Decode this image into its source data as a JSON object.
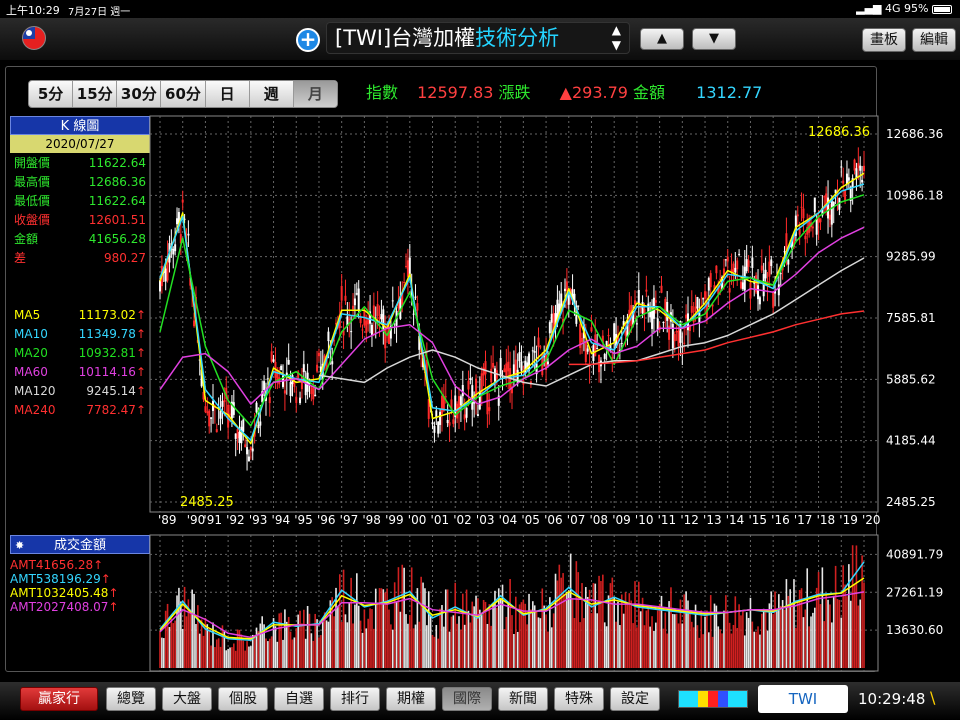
{
  "status": {
    "time": "上午10:29",
    "date": "7月27日 週一",
    "signal": "4G",
    "battery": "95%"
  },
  "header": {
    "title_prefix": "[TWI]",
    "title_main": "台灣加權",
    "title_accent": "技術分析",
    "btn_board": "畫板",
    "btn_edit": "編輯"
  },
  "periods": [
    "5分",
    "15分",
    "30分",
    "60分",
    "日",
    "週",
    "月"
  ],
  "active_period": "月",
  "quote": {
    "index_label": "指數",
    "index_value": "12597.83",
    "change_label": "漲跌",
    "change_value": "▲293.79",
    "amount_label": "金額",
    "amount_value": "1312.77"
  },
  "kline": {
    "header": "K 線圖",
    "date": "2020/07/27",
    "fields": [
      {
        "label": "開盤價",
        "value": "11622.64",
        "color": "#2ee82e"
      },
      {
        "label": "最高價",
        "value": "12686.36",
        "color": "#2ee82e"
      },
      {
        "label": "最低價",
        "value": "11622.64",
        "color": "#2ee82e"
      },
      {
        "label": "收盤價",
        "value": "12601.51",
        "color": "#ff3030"
      },
      {
        "label": "金額",
        "value": "41656.28",
        "color": "#2ee82e"
      },
      {
        "label": "差",
        "value": "980.27",
        "color": "#ff3030"
      }
    ],
    "ma": [
      {
        "label": "MA5",
        "value": "11173.02",
        "arrow": "↑",
        "color": "#ffff00"
      },
      {
        "label": "MA10",
        "value": "11349.78",
        "arrow": "↑",
        "color": "#34d6ff"
      },
      {
        "label": "MA20",
        "value": "10932.81",
        "arrow": "↑",
        "color": "#22e022"
      },
      {
        "label": "MA60",
        "value": "10114.16",
        "arrow": "↑",
        "color": "#e040e0"
      },
      {
        "label": "MA120",
        "value": "9245.14",
        "arrow": "↑",
        "color": "#d8d8d8"
      },
      {
        "label": "MA240",
        "value": "7782.47",
        "arrow": "↑",
        "color": "#ff3030"
      }
    ]
  },
  "volume": {
    "header": "成交金額",
    "fields": [
      {
        "label": "AMT",
        "value": "41656.28",
        "arrow": "↑",
        "color": "#ff3030"
      },
      {
        "label": "AMT5",
        "value": "38196.29",
        "arrow": "↑",
        "color": "#34d6ff"
      },
      {
        "label": "AMT10",
        "value": "32405.48",
        "arrow": "↑",
        "color": "#ffff00"
      },
      {
        "label": "AMT20",
        "value": "27408.07",
        "arrow": "↑",
        "color": "#e040e0"
      }
    ]
  },
  "nav": [
    "總覽",
    "大盤",
    "個股",
    "自選",
    "排行",
    "期權",
    "國際",
    "新聞",
    "特殊",
    "設定"
  ],
  "nav_active": "國際",
  "brand": "贏家行",
  "bottom": {
    "symbol": "TWI",
    "clock": "10:29:48"
  },
  "chart_data": [
    {
      "type": "line",
      "title": "K 線圖",
      "x": [
        "'89",
        "'90",
        "'91",
        "'92",
        "'93",
        "'94",
        "'95",
        "'96",
        "'97",
        "'98",
        "'99",
        "'00",
        "'01",
        "'02",
        "'03",
        "'04",
        "'05",
        "'06",
        "'07",
        "'08",
        "'09",
        "'10",
        "'11",
        "'12",
        "'13",
        "'14",
        "'15",
        "'16",
        "'17",
        "'18",
        "'19",
        "'20"
      ],
      "y_ticks": [
        "12686.36",
        "10986.18",
        "9285.99",
        "7585.81",
        "5885.62",
        "4185.44",
        "2485.25"
      ],
      "ylim": [
        2485.25,
        12686.36
      ],
      "annotations": {
        "max": "12686.36",
        "min": "2485.25"
      },
      "series": [
        {
          "name": "MA5",
          "values": [
            8600,
            10500,
            5300,
            4900,
            4100,
            6200,
            5800,
            5900,
            7800,
            7800,
            7300,
            8800,
            4800,
            5000,
            5500,
            5900,
            6100,
            6700,
            8400,
            6600,
            6900,
            8000,
            7800,
            7300,
            8000,
            8900,
            8600,
            8500,
            10100,
            10500,
            11200,
            11600
          ]
        },
        {
          "name": "MA10",
          "values": [
            8700,
            10400,
            5600,
            4800,
            4200,
            6100,
            5900,
            5800,
            7700,
            7600,
            7400,
            8700,
            5100,
            5000,
            5400,
            5900,
            6000,
            6600,
            8300,
            6900,
            6700,
            7900,
            7900,
            7300,
            7900,
            8800,
            8700,
            8400,
            10000,
            10500,
            11100,
            11300
          ]
        },
        {
          "name": "MA20",
          "values": [
            7200,
            9800,
            6800,
            5300,
            4600,
            5800,
            6100,
            5600,
            7200,
            7900,
            7100,
            8300,
            5900,
            4900,
            5400,
            5700,
            5900,
            6400,
            7800,
            7500,
            6300,
            7600,
            7900,
            7400,
            7700,
            8600,
            8700,
            8500,
            9700,
            10400,
            10800,
            11000
          ]
        },
        {
          "name": "MA60",
          "values": [
            5600,
            6500,
            6600,
            6100,
            5200,
            5800,
            5900,
            5600,
            6300,
            7000,
            7300,
            7400,
            6900,
            5700,
            5200,
            5400,
            5900,
            6200,
            6700,
            7000,
            6600,
            6800,
            7300,
            7300,
            7500,
            8000,
            8400,
            8300,
            8800,
            9400,
            9800,
            10100
          ]
        },
        {
          "name": "MA120",
          "values": [
            null,
            null,
            null,
            null,
            null,
            null,
            null,
            6000,
            5900,
            5800,
            6200,
            6500,
            6700,
            6500,
            6200,
            6000,
            5800,
            5700,
            6000,
            6300,
            6400,
            6400,
            6600,
            6800,
            6900,
            7100,
            7400,
            7700,
            8100,
            8500,
            8900,
            9250
          ]
        },
        {
          "name": "MA240",
          "values": [
            null,
            null,
            null,
            null,
            null,
            null,
            null,
            null,
            null,
            null,
            null,
            null,
            null,
            null,
            null,
            null,
            null,
            null,
            6300,
            6300,
            6350,
            6400,
            6500,
            6600,
            6700,
            6900,
            7050,
            7200,
            7400,
            7550,
            7700,
            7780
          ]
        }
      ]
    },
    {
      "type": "bar",
      "title": "成交金額",
      "y_ticks": [
        "40891.79",
        "27261.19",
        "13630.60"
      ],
      "series": [
        {
          "name": "AMT5",
          "values": [
            14000,
            24000,
            14000,
            10500,
            10000,
            16500,
            15000,
            16000,
            28000,
            22000,
            24000,
            27500,
            18000,
            22000,
            18000,
            26000,
            19000,
            21500,
            29000,
            22000,
            25500,
            22000,
            21000,
            20000,
            19000,
            20000,
            21000,
            20000,
            24000,
            26500,
            27000,
            38200
          ]
        },
        {
          "name": "AMT10",
          "values": [
            13500,
            23000,
            15000,
            11000,
            10500,
            15500,
            15500,
            15500,
            26000,
            22500,
            23500,
            26500,
            19000,
            21000,
            18500,
            25000,
            19500,
            21000,
            27500,
            23000,
            24500,
            22500,
            21500,
            20500,
            19500,
            20000,
            21000,
            20500,
            23500,
            26000,
            27000,
            32400
          ]
        },
        {
          "name": "AMT20",
          "values": [
            13000,
            21000,
            17500,
            12500,
            11000,
            14000,
            15500,
            15500,
            23500,
            23500,
            23000,
            25000,
            21000,
            20000,
            19000,
            23000,
            20500,
            20500,
            25000,
            24500,
            23000,
            23000,
            22000,
            21000,
            20000,
            20000,
            21000,
            21000,
            22500,
            25000,
            26000,
            27400
          ]
        }
      ]
    }
  ]
}
